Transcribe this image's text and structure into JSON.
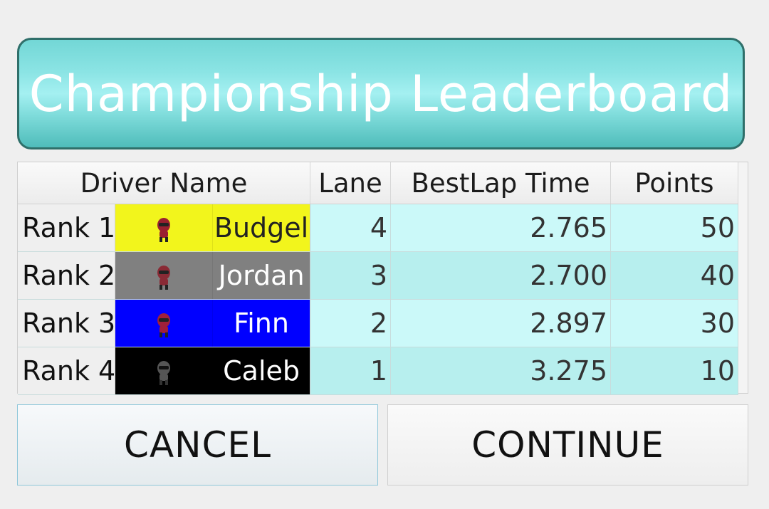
{
  "title": "Championship Leaderboard",
  "headers": {
    "driver_name": "Driver Name",
    "lane": "Lane",
    "best_lap": "BestLap Time",
    "points": "Points"
  },
  "rows": [
    {
      "rank": "Rank 1",
      "name": "Budgel",
      "lane": "4",
      "best_lap": "2.765",
      "points": "50",
      "color": "#f2f51c",
      "text_color": "#222222",
      "helmet_color": "#9a2030"
    },
    {
      "rank": "Rank 2",
      "name": "Jordan",
      "lane": "3",
      "best_lap": "2.700",
      "points": "40",
      "color": "#808080",
      "text_color": "#ffffff",
      "helmet_color": "#8a2a35"
    },
    {
      "rank": "Rank 3",
      "name": "Finn",
      "lane": "2",
      "best_lap": "2.897",
      "points": "30",
      "color": "#0000ff",
      "text_color": "#ffffff",
      "helmet_color": "#a0203a"
    },
    {
      "rank": "Rank 4",
      "name": "Caleb",
      "lane": "1",
      "best_lap": "3.275",
      "points": "10",
      "color": "#000000",
      "text_color": "#ffffff",
      "helmet_color": "#555555"
    }
  ],
  "buttons": {
    "cancel": "CANCEL",
    "continue": "CONTINUE"
  }
}
